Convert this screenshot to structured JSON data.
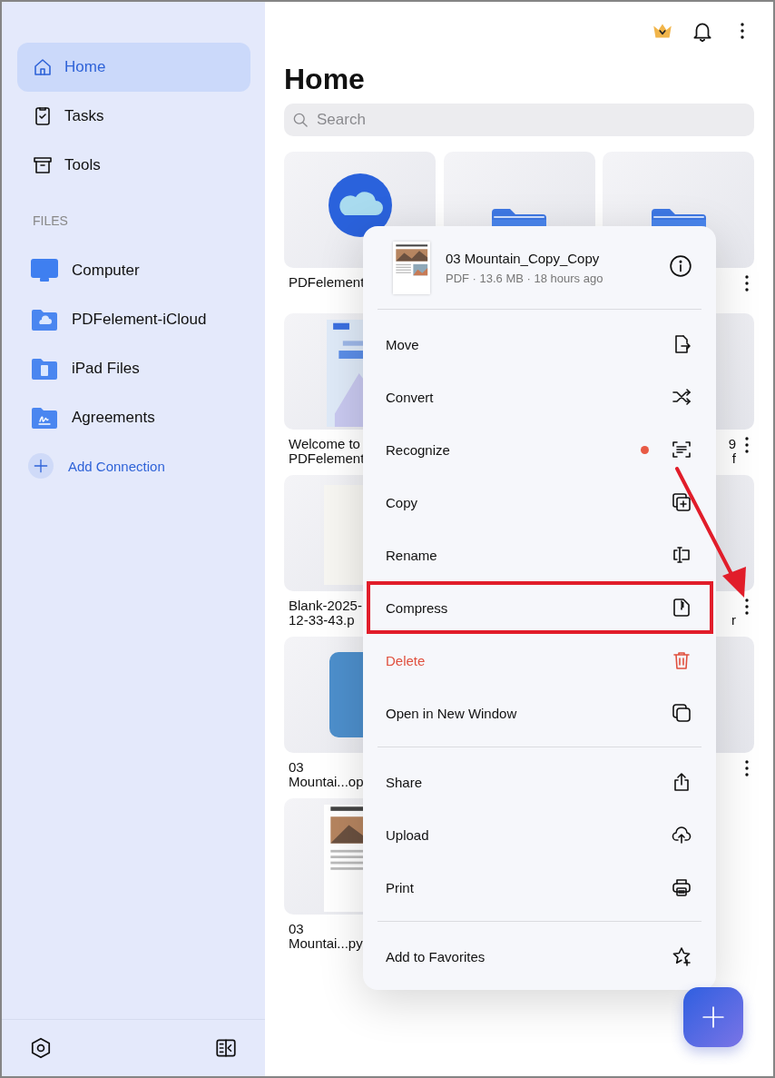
{
  "sidebar": {
    "nav": [
      {
        "label": "Home",
        "kind": "home",
        "selected": true
      },
      {
        "label": "Tasks",
        "kind": "tasks",
        "selected": false
      },
      {
        "label": "Tools",
        "kind": "tools",
        "selected": false
      }
    ],
    "section_title": "FILES",
    "locations": [
      {
        "label": "Computer",
        "kind": "computer"
      },
      {
        "label": "PDFelement-iCloud",
        "kind": "cloud"
      },
      {
        "label": "iPad Files",
        "kind": "ipad"
      },
      {
        "label": "Agreements",
        "kind": "sign"
      }
    ],
    "add_connection": "Add Connection"
  },
  "page_title": "Home",
  "search": {
    "placeholder": "Search"
  },
  "files": [
    {
      "kind": "cloud",
      "lines": [
        "PDFelement"
      ],
      "more_button": false
    },
    {
      "kind": "folder",
      "more_button": false
    },
    {
      "kind": "folder",
      "more_button": true
    },
    {
      "kind": "welcome",
      "lines": [
        "Welcome to",
        "PDFelement"
      ],
      "more_button": false
    },
    {
      "kind": "covered"
    },
    {
      "kind": "plain",
      "lines": [
        "9",
        "f"
      ],
      "more_button": true
    },
    {
      "kind": "blank",
      "lines": [
        "Blank-2025-",
        "12-33-43.p"
      ],
      "more_button": false
    },
    {
      "kind": "covered"
    },
    {
      "kind": "plain",
      "lines": [
        "r"
      ],
      "more_button": true
    },
    {
      "kind": "word",
      "lines": [
        "03",
        "Mountai...op"
      ],
      "more_button": false
    },
    {
      "kind": "covered"
    },
    {
      "kind": "plain",
      "more_button": true
    },
    {
      "kind": "article",
      "lines": [
        "03",
        "Mountai...py"
      ],
      "more_button": false
    }
  ],
  "context_menu": {
    "file_name": "03 Mountain_Copy_Copy",
    "file_meta": "PDF · 13.6 MB · 18 hours ago",
    "groups": [
      [
        {
          "label": "Move",
          "kind": "move",
          "danger": false,
          "badge": false,
          "highlighted": false
        },
        {
          "label": "Convert",
          "kind": "convert",
          "danger": false,
          "badge": false,
          "highlighted": false
        },
        {
          "label": "Recognize",
          "kind": "recognize",
          "danger": false,
          "badge": true,
          "highlighted": false
        },
        {
          "label": "Copy",
          "kind": "copy",
          "danger": false,
          "badge": false,
          "highlighted": false
        },
        {
          "label": "Rename",
          "kind": "rename",
          "danger": false,
          "badge": false,
          "highlighted": false
        },
        {
          "label": "Compress",
          "kind": "compress",
          "danger": false,
          "badge": false,
          "highlighted": true
        },
        {
          "label": "Delete",
          "kind": "delete",
          "danger": true,
          "badge": false,
          "highlighted": false
        },
        {
          "label": "Open in New Window",
          "kind": "window",
          "danger": false,
          "badge": false,
          "highlighted": false
        }
      ],
      [
        {
          "label": "Share",
          "kind": "share",
          "danger": false,
          "badge": false,
          "highlighted": false
        },
        {
          "label": "Upload",
          "kind": "upload",
          "danger": false,
          "badge": false,
          "highlighted": false
        },
        {
          "label": "Print",
          "kind": "print",
          "danger": false,
          "badge": false,
          "highlighted": false
        }
      ],
      [
        {
          "label": "Add to Favorites",
          "kind": "favorite",
          "danger": false,
          "badge": false,
          "highlighted": false
        }
      ]
    ]
  },
  "annotation_arrow": true
}
